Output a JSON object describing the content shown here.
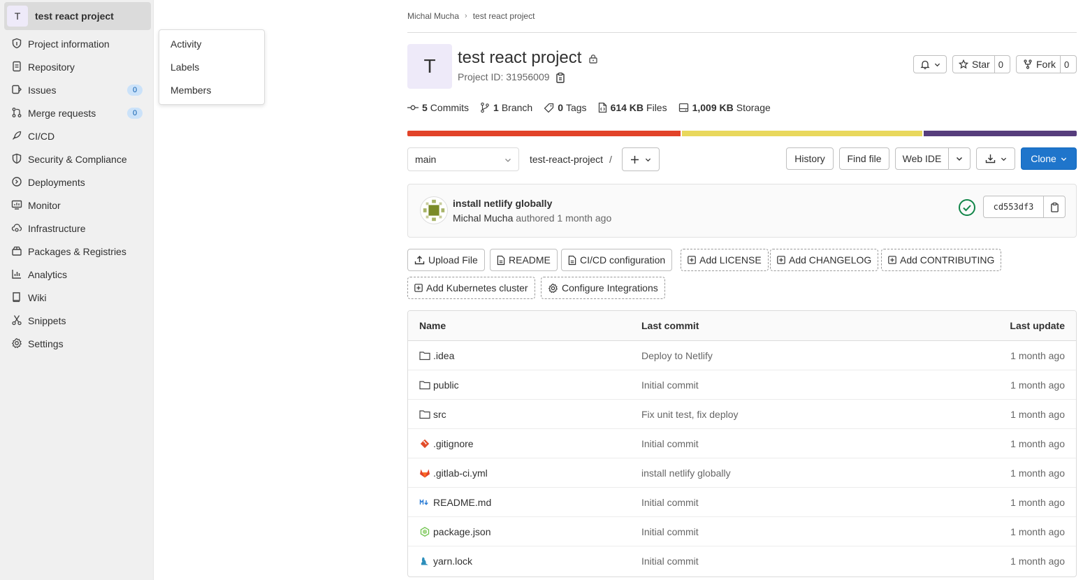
{
  "sidebar": {
    "project_avatar": "T",
    "project_name": "test react project",
    "items": [
      {
        "label": "Project information",
        "icon": "info-icon"
      },
      {
        "label": "Repository",
        "icon": "doc-icon"
      },
      {
        "label": "Issues",
        "icon": "issues-icon",
        "count": "0"
      },
      {
        "label": "Merge requests",
        "icon": "merge-icon",
        "count": "0"
      },
      {
        "label": "CI/CD",
        "icon": "rocket-icon"
      },
      {
        "label": "Security & Compliance",
        "icon": "shield-icon"
      },
      {
        "label": "Deployments",
        "icon": "deploy-icon"
      },
      {
        "label": "Monitor",
        "icon": "monitor-icon"
      },
      {
        "label": "Infrastructure",
        "icon": "cloud-gear-icon"
      },
      {
        "label": "Packages & Registries",
        "icon": "package-icon"
      },
      {
        "label": "Analytics",
        "icon": "chart-icon"
      },
      {
        "label": "Wiki",
        "icon": "book-icon"
      },
      {
        "label": "Snippets",
        "icon": "scissors-icon"
      },
      {
        "label": "Settings",
        "icon": "gear-icon"
      }
    ]
  },
  "flyout": {
    "items": [
      "Activity",
      "Labels",
      "Members"
    ]
  },
  "breadcrumb": {
    "owner": "Michal Mucha",
    "project": "test react project"
  },
  "header": {
    "avatar": "T",
    "title": "test react project",
    "project_id": "Project ID: 31956009",
    "star_label": "Star",
    "star_count": "0",
    "fork_label": "Fork",
    "fork_count": "0"
  },
  "stats": {
    "commits_num": "5",
    "commits_label": "Commits",
    "branch_num": "1",
    "branch_label": "Branch",
    "tags_num": "0",
    "tags_label": "Tags",
    "files_num": "614 KB",
    "files_label": "Files",
    "storage_num": "1,009 KB",
    "storage_label": "Storage"
  },
  "languages": [
    {
      "color": "#e24329",
      "share": 41
    },
    {
      "color": "#e9d85d",
      "share": 36
    },
    {
      "color": "#563d7c",
      "share": 23
    }
  ],
  "toolbar": {
    "branch": "main",
    "path": "test-react-project",
    "path_sep": "/",
    "history": "History",
    "find_file": "Find file",
    "web_ide": "Web IDE",
    "clone": "Clone"
  },
  "commit": {
    "title": "install netlify globally",
    "author": "Michal Mucha",
    "meta": "authored 1 month ago",
    "sha": "cd553df3",
    "status_color": "#108548"
  },
  "quick_actions": {
    "upload": "Upload File",
    "readme": "README",
    "cicd": "CI/CD configuration",
    "license": "Add LICENSE",
    "changelog": "Add CHANGELOG",
    "contributing": "Add CONTRIBUTING",
    "kubernetes": "Add Kubernetes cluster",
    "integrations": "Configure Integrations"
  },
  "table": {
    "headers": {
      "name": "Name",
      "last_commit": "Last commit",
      "last_update": "Last update"
    },
    "rows": [
      {
        "name": ".idea",
        "icon": "folder-icon",
        "commit": "Deploy to Netlify",
        "updated": "1 month ago"
      },
      {
        "name": "public",
        "icon": "folder-icon",
        "commit": "Initial commit",
        "updated": "1 month ago"
      },
      {
        "name": "src",
        "icon": "folder-icon",
        "commit": "Fix unit test, fix deploy",
        "updated": "1 month ago"
      },
      {
        "name": ".gitignore",
        "icon": "git-icon",
        "commit": "Initial commit",
        "updated": "1 month ago"
      },
      {
        "name": ".gitlab-ci.yml",
        "icon": "gitlab-icon",
        "commit": "install netlify globally",
        "updated": "1 month ago"
      },
      {
        "name": "README.md",
        "icon": "markdown-icon",
        "commit": "Initial commit",
        "updated": "1 month ago"
      },
      {
        "name": "package.json",
        "icon": "node-icon",
        "commit": "Initial commit",
        "updated": "1 month ago"
      },
      {
        "name": "yarn.lock",
        "icon": "yarn-icon",
        "commit": "Initial commit",
        "updated": "1 month ago"
      }
    ]
  }
}
